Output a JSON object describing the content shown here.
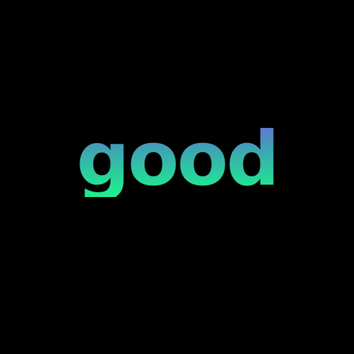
{
  "text": "good",
  "colors": {
    "background": "#000000",
    "gradient_top": "#6a6fd6",
    "gradient_bottom": "#1ff08d"
  }
}
